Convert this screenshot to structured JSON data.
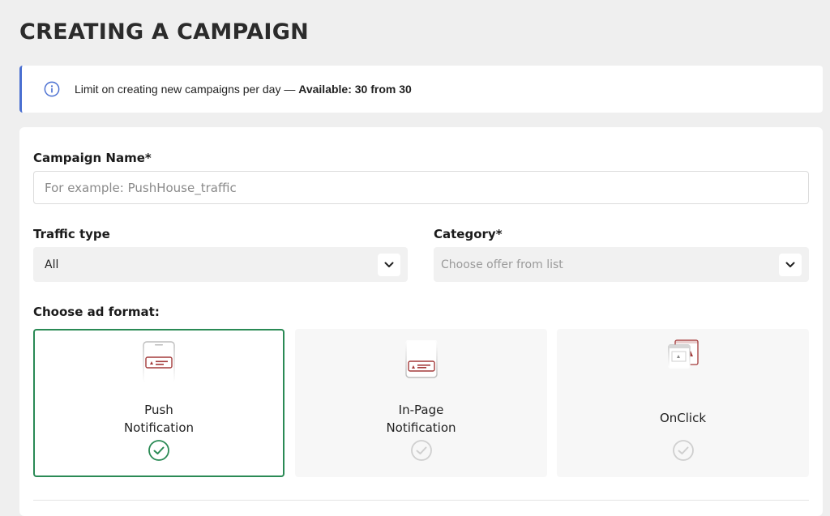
{
  "page": {
    "title": "CREATING A CAMPAIGN"
  },
  "banner": {
    "icon": "info-icon",
    "text": "Limit on creating new campaigns per day — ",
    "available": "Available: 30 from 30",
    "accent_color": "#4a6fd1"
  },
  "form": {
    "campaign_name": {
      "label": "Campaign Name*",
      "value": "",
      "placeholder": "For example: PushHouse_traffic"
    },
    "traffic_type": {
      "label": "Traffic type",
      "selected": "All"
    },
    "category": {
      "label": "Category*",
      "placeholder": "Choose offer from list"
    },
    "ad_format": {
      "label": "Choose ad format:",
      "options": [
        {
          "name": "Push\nNotification",
          "icon": "push-notification-icon",
          "selected": true
        },
        {
          "name": "In-Page\nNotification",
          "icon": "in-page-notification-icon",
          "selected": false
        },
        {
          "name": "OnClick",
          "icon": "onclick-icon",
          "selected": false
        }
      ],
      "selected_color": "#2a8a55",
      "unselected_check_color": "#cfcfcf"
    }
  }
}
